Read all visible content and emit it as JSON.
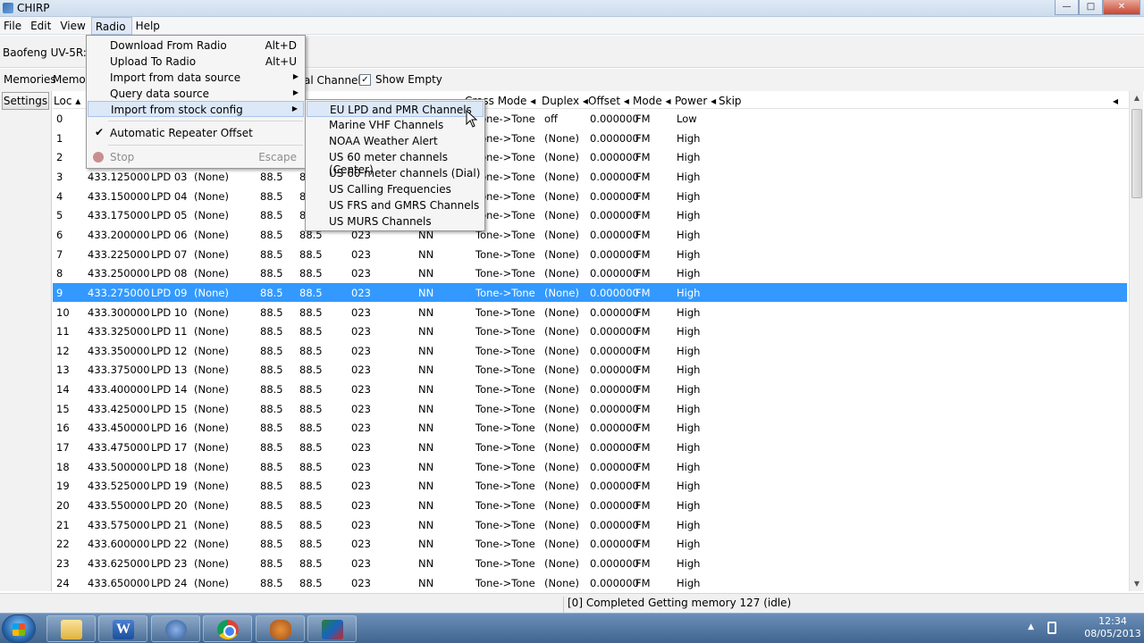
{
  "window": {
    "title": "CHIRP"
  },
  "menubar": {
    "items": [
      "File",
      "Edit",
      "View",
      "Radio",
      "Help"
    ]
  },
  "radio_label": "Baofeng UV-5R: (U",
  "tabs": {
    "memories": "Memories",
    "memories2": "Memor"
  },
  "filters": {
    "channels_label": "al Channels",
    "show_empty": "Show Empty"
  },
  "settings_button": "Settings",
  "grid": {
    "headers": [
      "Loc",
      "Cross Mode",
      "Duplex",
      "Offset",
      "Mode",
      "Power",
      "Skip"
    ],
    "partial_headers": [
      "Sql ◂",
      "DTCS Code ◂",
      "DTCS Pol ◂"
    ],
    "rows": [
      [
        "0",
        "",
        "",
        "",
        "",
        "",
        "",
        "",
        "Tone->Tone",
        "off",
        "0.000000",
        "FM",
        "Low"
      ],
      [
        "1",
        "",
        "",
        "",
        "",
        "",
        "",
        "",
        "Tone->Tone",
        "(None)",
        "0.000000",
        "FM",
        "High"
      ],
      [
        "2",
        "",
        "",
        "",
        "",
        "",
        "",
        "",
        "Tone->Tone",
        "(None)",
        "0.000000",
        "FM",
        "High"
      ],
      [
        "3",
        "433.125000",
        "LPD 03",
        "(None)",
        "88.5",
        "8",
        "",
        "",
        "Tone->Tone",
        "(None)",
        "0.000000",
        "FM",
        "High"
      ],
      [
        "4",
        "433.150000",
        "LPD 04",
        "(None)",
        "88.5",
        "8",
        "",
        "",
        "Tone->Tone",
        "(None)",
        "0.000000",
        "FM",
        "High"
      ],
      [
        "5",
        "433.175000",
        "LPD 05",
        "(None)",
        "88.5",
        "8",
        "",
        "",
        "Tone->Tone",
        "(None)",
        "0.000000",
        "FM",
        "High"
      ],
      [
        "6",
        "433.200000",
        "LPD 06",
        "(None)",
        "88.5",
        "88.5",
        "023",
        "NN",
        "Tone->Tone",
        "(None)",
        "0.000000",
        "FM",
        "High"
      ],
      [
        "7",
        "433.225000",
        "LPD 07",
        "(None)",
        "88.5",
        "88.5",
        "023",
        "NN",
        "Tone->Tone",
        "(None)",
        "0.000000",
        "FM",
        "High"
      ],
      [
        "8",
        "433.250000",
        "LPD 08",
        "(None)",
        "88.5",
        "88.5",
        "023",
        "NN",
        "Tone->Tone",
        "(None)",
        "0.000000",
        "FM",
        "High"
      ],
      [
        "9",
        "433.275000",
        "LPD 09",
        "(None)",
        "88.5",
        "88.5",
        "023",
        "NN",
        "Tone->Tone",
        "(None)",
        "0.000000",
        "FM",
        "High"
      ],
      [
        "10",
        "433.300000",
        "LPD 10",
        "(None)",
        "88.5",
        "88.5",
        "023",
        "NN",
        "Tone->Tone",
        "(None)",
        "0.000000",
        "FM",
        "High"
      ],
      [
        "11",
        "433.325000",
        "LPD 11",
        "(None)",
        "88.5",
        "88.5",
        "023",
        "NN",
        "Tone->Tone",
        "(None)",
        "0.000000",
        "FM",
        "High"
      ],
      [
        "12",
        "433.350000",
        "LPD 12",
        "(None)",
        "88.5",
        "88.5",
        "023",
        "NN",
        "Tone->Tone",
        "(None)",
        "0.000000",
        "FM",
        "High"
      ],
      [
        "13",
        "433.375000",
        "LPD 13",
        "(None)",
        "88.5",
        "88.5",
        "023",
        "NN",
        "Tone->Tone",
        "(None)",
        "0.000000",
        "FM",
        "High"
      ],
      [
        "14",
        "433.400000",
        "LPD 14",
        "(None)",
        "88.5",
        "88.5",
        "023",
        "NN",
        "Tone->Tone",
        "(None)",
        "0.000000",
        "FM",
        "High"
      ],
      [
        "15",
        "433.425000",
        "LPD 15",
        "(None)",
        "88.5",
        "88.5",
        "023",
        "NN",
        "Tone->Tone",
        "(None)",
        "0.000000",
        "FM",
        "High"
      ],
      [
        "16",
        "433.450000",
        "LPD 16",
        "(None)",
        "88.5",
        "88.5",
        "023",
        "NN",
        "Tone->Tone",
        "(None)",
        "0.000000",
        "FM",
        "High"
      ],
      [
        "17",
        "433.475000",
        "LPD 17",
        "(None)",
        "88.5",
        "88.5",
        "023",
        "NN",
        "Tone->Tone",
        "(None)",
        "0.000000",
        "FM",
        "High"
      ],
      [
        "18",
        "433.500000",
        "LPD 18",
        "(None)",
        "88.5",
        "88.5",
        "023",
        "NN",
        "Tone->Tone",
        "(None)",
        "0.000000",
        "FM",
        "High"
      ],
      [
        "19",
        "433.525000",
        "LPD 19",
        "(None)",
        "88.5",
        "88.5",
        "023",
        "NN",
        "Tone->Tone",
        "(None)",
        "0.000000",
        "FM",
        "High"
      ],
      [
        "20",
        "433.550000",
        "LPD 20",
        "(None)",
        "88.5",
        "88.5",
        "023",
        "NN",
        "Tone->Tone",
        "(None)",
        "0.000000",
        "FM",
        "High"
      ],
      [
        "21",
        "433.575000",
        "LPD 21",
        "(None)",
        "88.5",
        "88.5",
        "023",
        "NN",
        "Tone->Tone",
        "(None)",
        "0.000000",
        "FM",
        "High"
      ],
      [
        "22",
        "433.600000",
        "LPD 22",
        "(None)",
        "88.5",
        "88.5",
        "023",
        "NN",
        "Tone->Tone",
        "(None)",
        "0.000000",
        "FM",
        "High"
      ],
      [
        "23",
        "433.625000",
        "LPD 23",
        "(None)",
        "88.5",
        "88.5",
        "023",
        "NN",
        "Tone->Tone",
        "(None)",
        "0.000000",
        "FM",
        "High"
      ],
      [
        "24",
        "433.650000",
        "LPD 24",
        "(None)",
        "88.5",
        "88.5",
        "023",
        "NN",
        "Tone->Tone",
        "(None)",
        "0.000000",
        "FM",
        "High"
      ]
    ],
    "selected_loc": "9"
  },
  "radio_menu": {
    "download": {
      "label": "Download From Radio",
      "accel": "Alt+D"
    },
    "upload": {
      "label": "Upload To Radio",
      "accel": "Alt+U"
    },
    "import_source": "Import from data source",
    "query_source": "Query data source",
    "import_stock": "Import from stock config",
    "auto_offset": "Automatic Repeater Offset",
    "stop": {
      "label": "Stop",
      "accel": "Escape"
    }
  },
  "stock_submenu": {
    "items": [
      "EU LPD and PMR Channels",
      "Marine VHF Channels",
      "NOAA Weather Alert",
      "US 60 meter channels (Center)",
      "US 60 meter channels (Dial)",
      "US Calling Frequencies",
      "US FRS and GMRS Channels",
      "US MURS Channels"
    ]
  },
  "status": "[0] Completed Getting memory 127 (idle)",
  "taskbar": {
    "time": "12:34",
    "date": "08/05/2013"
  },
  "colors": {
    "selection": "#3399ff",
    "menu_hover": "#dce8f7"
  }
}
